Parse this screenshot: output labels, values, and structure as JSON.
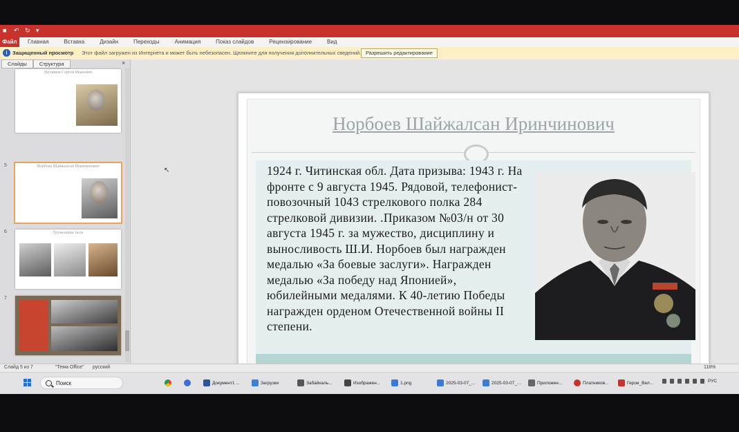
{
  "ribbon": {
    "file_tab": "Файл",
    "tabs": [
      "Главная",
      "Вставка",
      "Дизайн",
      "Переходы",
      "Анимация",
      "Показ слайдов",
      "Рецензирование",
      "Вид"
    ]
  },
  "protected_view": {
    "title": "Защищенный просмотр",
    "message": "Этот файл загружен из Интернета и может быть небезопасен. Щелкните для получения дополнительных сведений.",
    "button": "Разрешить редактирование"
  },
  "left_pane": {
    "tab_slides": "Слайды",
    "tab_outline": "Структура",
    "close": "×",
    "thumbs": [
      {
        "num": "",
        "title": "Лесников Сергей Иванович"
      },
      {
        "num": "5",
        "title": "Норбоев Шайжалсан Иринчинович"
      },
      {
        "num": "6",
        "title": "Труженицы тыла"
      },
      {
        "num": "7",
        "title": ""
      }
    ]
  },
  "slide": {
    "title": "Норбоев Шайжалсан Иринчинович",
    "body": "1924 г. Читинская обл. Дата призыва: 1943 г. На фронте с 9 августа 1945. Рядовой, телефонист-повозочный 1043 стрелкового полка 284 стрелковой дивизии. .Приказом №03/н от 30 августа 1945 г. за мужество, дисциплину и выносливость Ш.И. Норбоев был награжден медалью «За боевые заслуги». Награжден медалью «За победу над Японией», юбилейными медалями. К 40-летию Победы  награжден орденом Отечественной войны II степени."
  },
  "status_bar": {
    "slide_info": "Слайд 5 из 7",
    "theme": "\"Тема Office\"",
    "language": "русский",
    "zoom": "118%"
  },
  "taskbar": {
    "search": "Поиск",
    "apps": [
      {
        "label": "Документ1 ...",
        "color": "#2b579a"
      },
      {
        "label": "Загрузки",
        "color": "#3b82d6"
      },
      {
        "label": "Забайкаль...",
        "color": "#555555"
      },
      {
        "label": "Изображен...",
        "color": "#444444"
      },
      {
        "label": "1.png",
        "color": "#3a7bd5"
      },
      {
        "label": "2025-03-07_...",
        "color": "#3a7bd5"
      },
      {
        "label": "2025-03-07_...",
        "color": "#3a7bd5"
      },
      {
        "label": "Приложен...",
        "color": "#666666"
      },
      {
        "label": "Платников...",
        "color": "#c9322c"
      },
      {
        "label": "Герои_Вел...",
        "color": "#c9322c"
      }
    ],
    "lang": "РУС"
  }
}
